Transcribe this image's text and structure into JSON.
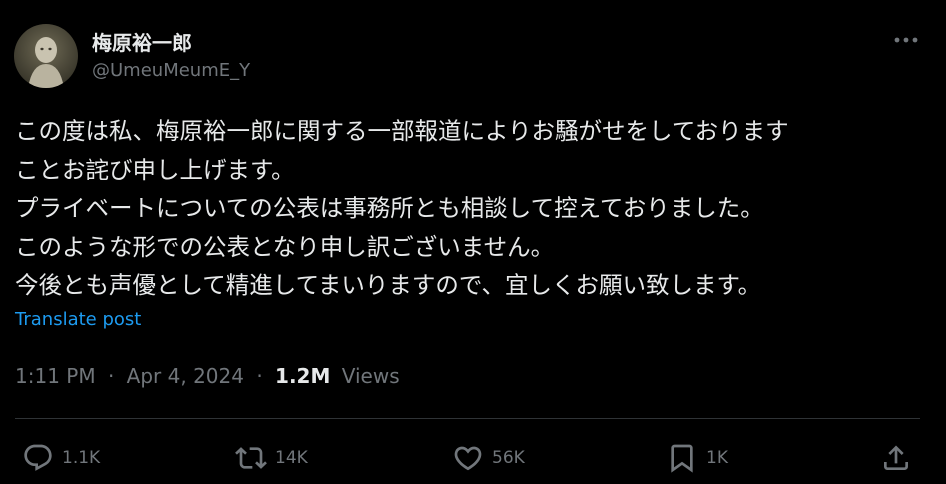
{
  "author": {
    "display_name": "梅原裕一郎",
    "handle": "@UmeuMeumE_Y"
  },
  "post": {
    "lines": [
      "この度は私、梅原裕一郎に関する一部報道によりお騒がせをしております",
      "ことお詫び申し上げます。",
      "プライベートについての公表は事務所とも相談して控えておりました。",
      "このような形での公表となり申し訳ございません。",
      "今後とも声優として精進してまいりますので、宜しくお願い致します。"
    ],
    "translate_label": "Translate post"
  },
  "meta": {
    "time": "1:11 PM",
    "separator": "·",
    "date": "Apr 4, 2024",
    "views_count": "1.2M",
    "views_label": "Views"
  },
  "actions": {
    "replies": "1.1K",
    "reposts": "14K",
    "likes": "56K",
    "bookmarks": "1K"
  },
  "colors": {
    "background": "#000000",
    "primary_text": "#e7e9ea",
    "secondary_text": "#71767b",
    "link": "#1d9bf0",
    "divider": "#2f3336"
  },
  "icons": [
    "more-icon",
    "reply-icon",
    "repost-icon",
    "like-icon",
    "bookmark-icon",
    "share-icon"
  ]
}
